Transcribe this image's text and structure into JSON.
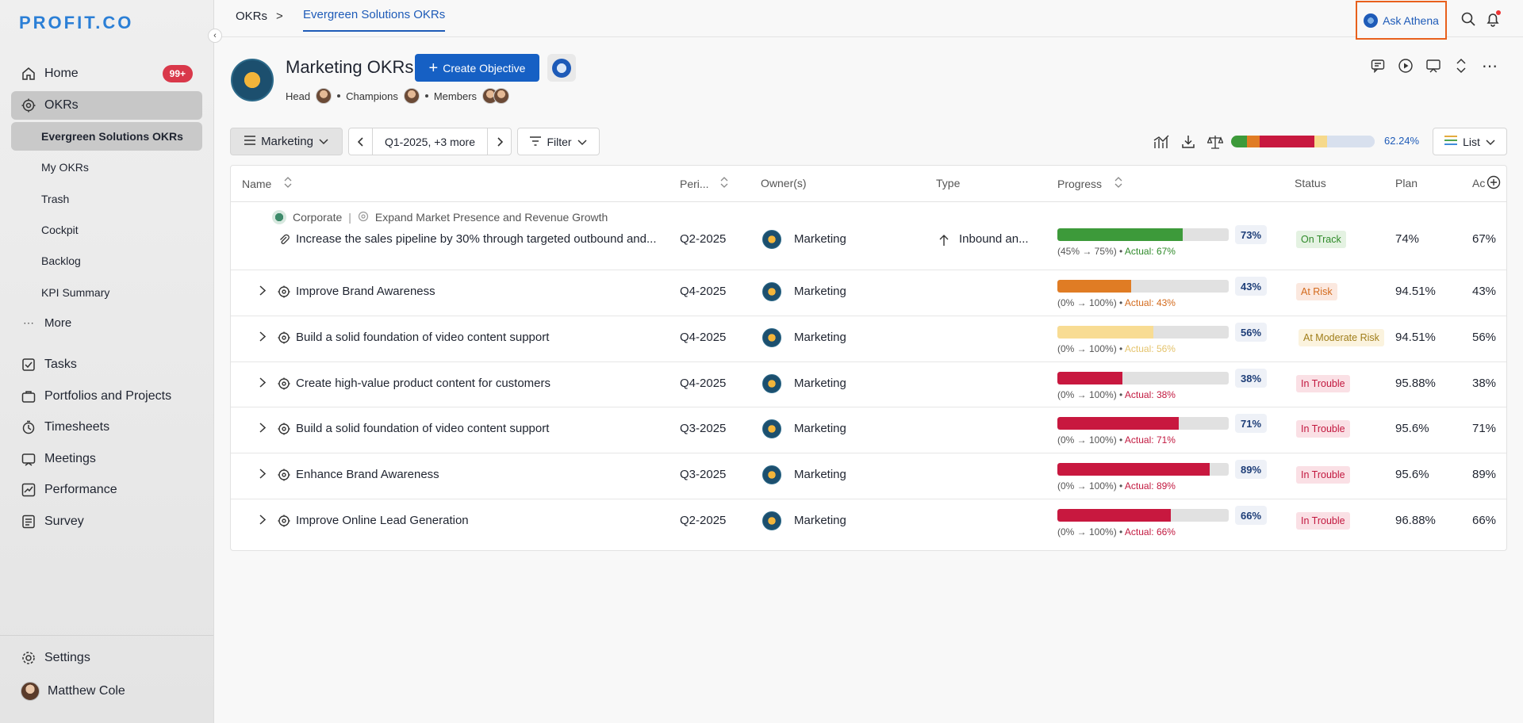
{
  "sidebar": {
    "logo": "PROFIT.CO",
    "nav": [
      {
        "label": "Home",
        "icon": "home-icon",
        "badge": "99+"
      },
      {
        "label": "OKRs",
        "icon": "target-icon"
      }
    ],
    "sub": [
      "Evergreen Solutions OKRs",
      "My OKRs",
      "Trash",
      "Cockpit",
      "Backlog",
      "KPI Summary"
    ],
    "more": "More",
    "nav2": [
      {
        "label": "Tasks",
        "icon": "tasks-icon"
      },
      {
        "label": "Portfolios and Projects",
        "icon": "briefcase-icon"
      },
      {
        "label": "Timesheets",
        "icon": "clock-icon"
      },
      {
        "label": "Meetings",
        "icon": "meetings-icon"
      },
      {
        "label": "Performance",
        "icon": "chart-icon"
      },
      {
        "label": "Survey",
        "icon": "survey-icon"
      }
    ],
    "settings": "Settings",
    "user": "Matthew Cole"
  },
  "topbar": {
    "crumb1": "OKRs",
    "crumb_sep": ">",
    "crumb2": "Evergreen Solutions OKRs",
    "ask_athena": "Ask Athena"
  },
  "header": {
    "title": "Marketing OKRs",
    "create_button": "Create Objective",
    "head_label": "Head",
    "champions_label": "Champions",
    "members_label": "Members"
  },
  "toolbar": {
    "team": "Marketing",
    "period": "Q1-2025, +3 more",
    "filter": "Filter",
    "summary_pct": "62.24%",
    "view": "List",
    "summary_segments": [
      {
        "color": "#3d9a3a",
        "fraction": 0.11
      },
      {
        "color": "#e07c24",
        "fraction": 0.09
      },
      {
        "color": "#c8183f",
        "fraction": 0.38
      },
      {
        "color": "#f6d98b",
        "fraction": 0.09
      },
      {
        "color": "#d8e0ee",
        "fraction": 0.33
      }
    ]
  },
  "table": {
    "columns": {
      "name": "Name",
      "period": "Peri...",
      "owner": "Owner(s)",
      "type": "Type",
      "progress": "Progress",
      "status": "Status",
      "plan": "Plan",
      "actual": "Ac"
    },
    "parent": {
      "level": "Corporate",
      "sep": "|",
      "objective": "Expand Market Presence and Revenue Growth"
    },
    "rows": [
      {
        "name": "Increase the sales pipeline by 30% through targeted outbound and...",
        "period": "Q2-2025",
        "owner": "Marketing",
        "type": "Inbound an...",
        "progress": 0.73,
        "pct": "73%",
        "range": "(45% → 75%)",
        "actual": "Actual: 67%",
        "status": "On Track",
        "plan": "74%",
        "actual_col": "67%",
        "color": "#3d9a3a",
        "is_kr": true
      },
      {
        "name": "Improve Brand Awareness",
        "period": "Q4-2025",
        "owner": "Marketing",
        "type": "",
        "progress": 0.43,
        "pct": "43%",
        "range": "(0% → 100%)",
        "actual": "Actual: 43%",
        "status": "At Risk",
        "plan": "94.51%",
        "actual_col": "43%",
        "color": "#e07c24",
        "is_kr": false
      },
      {
        "name": "Build a solid foundation of video content support",
        "period": "Q4-2025",
        "owner": "Marketing",
        "type": "",
        "progress": 0.56,
        "pct": "56%",
        "range": "(0% → 100%)",
        "actual": "Actual: 56%",
        "status": "At Moderate Risk",
        "plan": "94.51%",
        "actual_col": "56%",
        "color": "#f8dc93",
        "is_kr": false
      },
      {
        "name": "Create high-value product content for customers",
        "period": "Q4-2025",
        "owner": "Marketing",
        "type": "",
        "progress": 0.38,
        "pct": "38%",
        "range": "(0% → 100%)",
        "actual": "Actual: 38%",
        "status": "In Trouble",
        "plan": "95.88%",
        "actual_col": "38%",
        "color": "#c8183f",
        "is_kr": false
      },
      {
        "name": "Build a solid foundation of video content support",
        "period": "Q3-2025",
        "owner": "Marketing",
        "type": "",
        "progress": 0.71,
        "pct": "71%",
        "range": "(0% → 100%)",
        "actual": "Actual: 71%",
        "status": "In Trouble",
        "plan": "95.6%",
        "actual_col": "71%",
        "color": "#c8183f",
        "is_kr": false
      },
      {
        "name": "Enhance Brand Awareness",
        "period": "Q3-2025",
        "owner": "Marketing",
        "type": "",
        "progress": 0.89,
        "pct": "89%",
        "range": "(0% → 100%)",
        "actual": "Actual: 89%",
        "status": "In Trouble",
        "plan": "95.6%",
        "actual_col": "89%",
        "color": "#c8183f",
        "is_kr": false
      },
      {
        "name": "Improve Online Lead Generation",
        "period": "Q2-2025",
        "owner": "Marketing",
        "type": "",
        "progress": 0.66,
        "pct": "66%",
        "range": "(0% → 100%)",
        "actual": "Actual: 66%",
        "status": "In Trouble",
        "plan": "96.88%",
        "actual_col": "66%",
        "color": "#c8183f",
        "is_kr": false
      }
    ]
  }
}
